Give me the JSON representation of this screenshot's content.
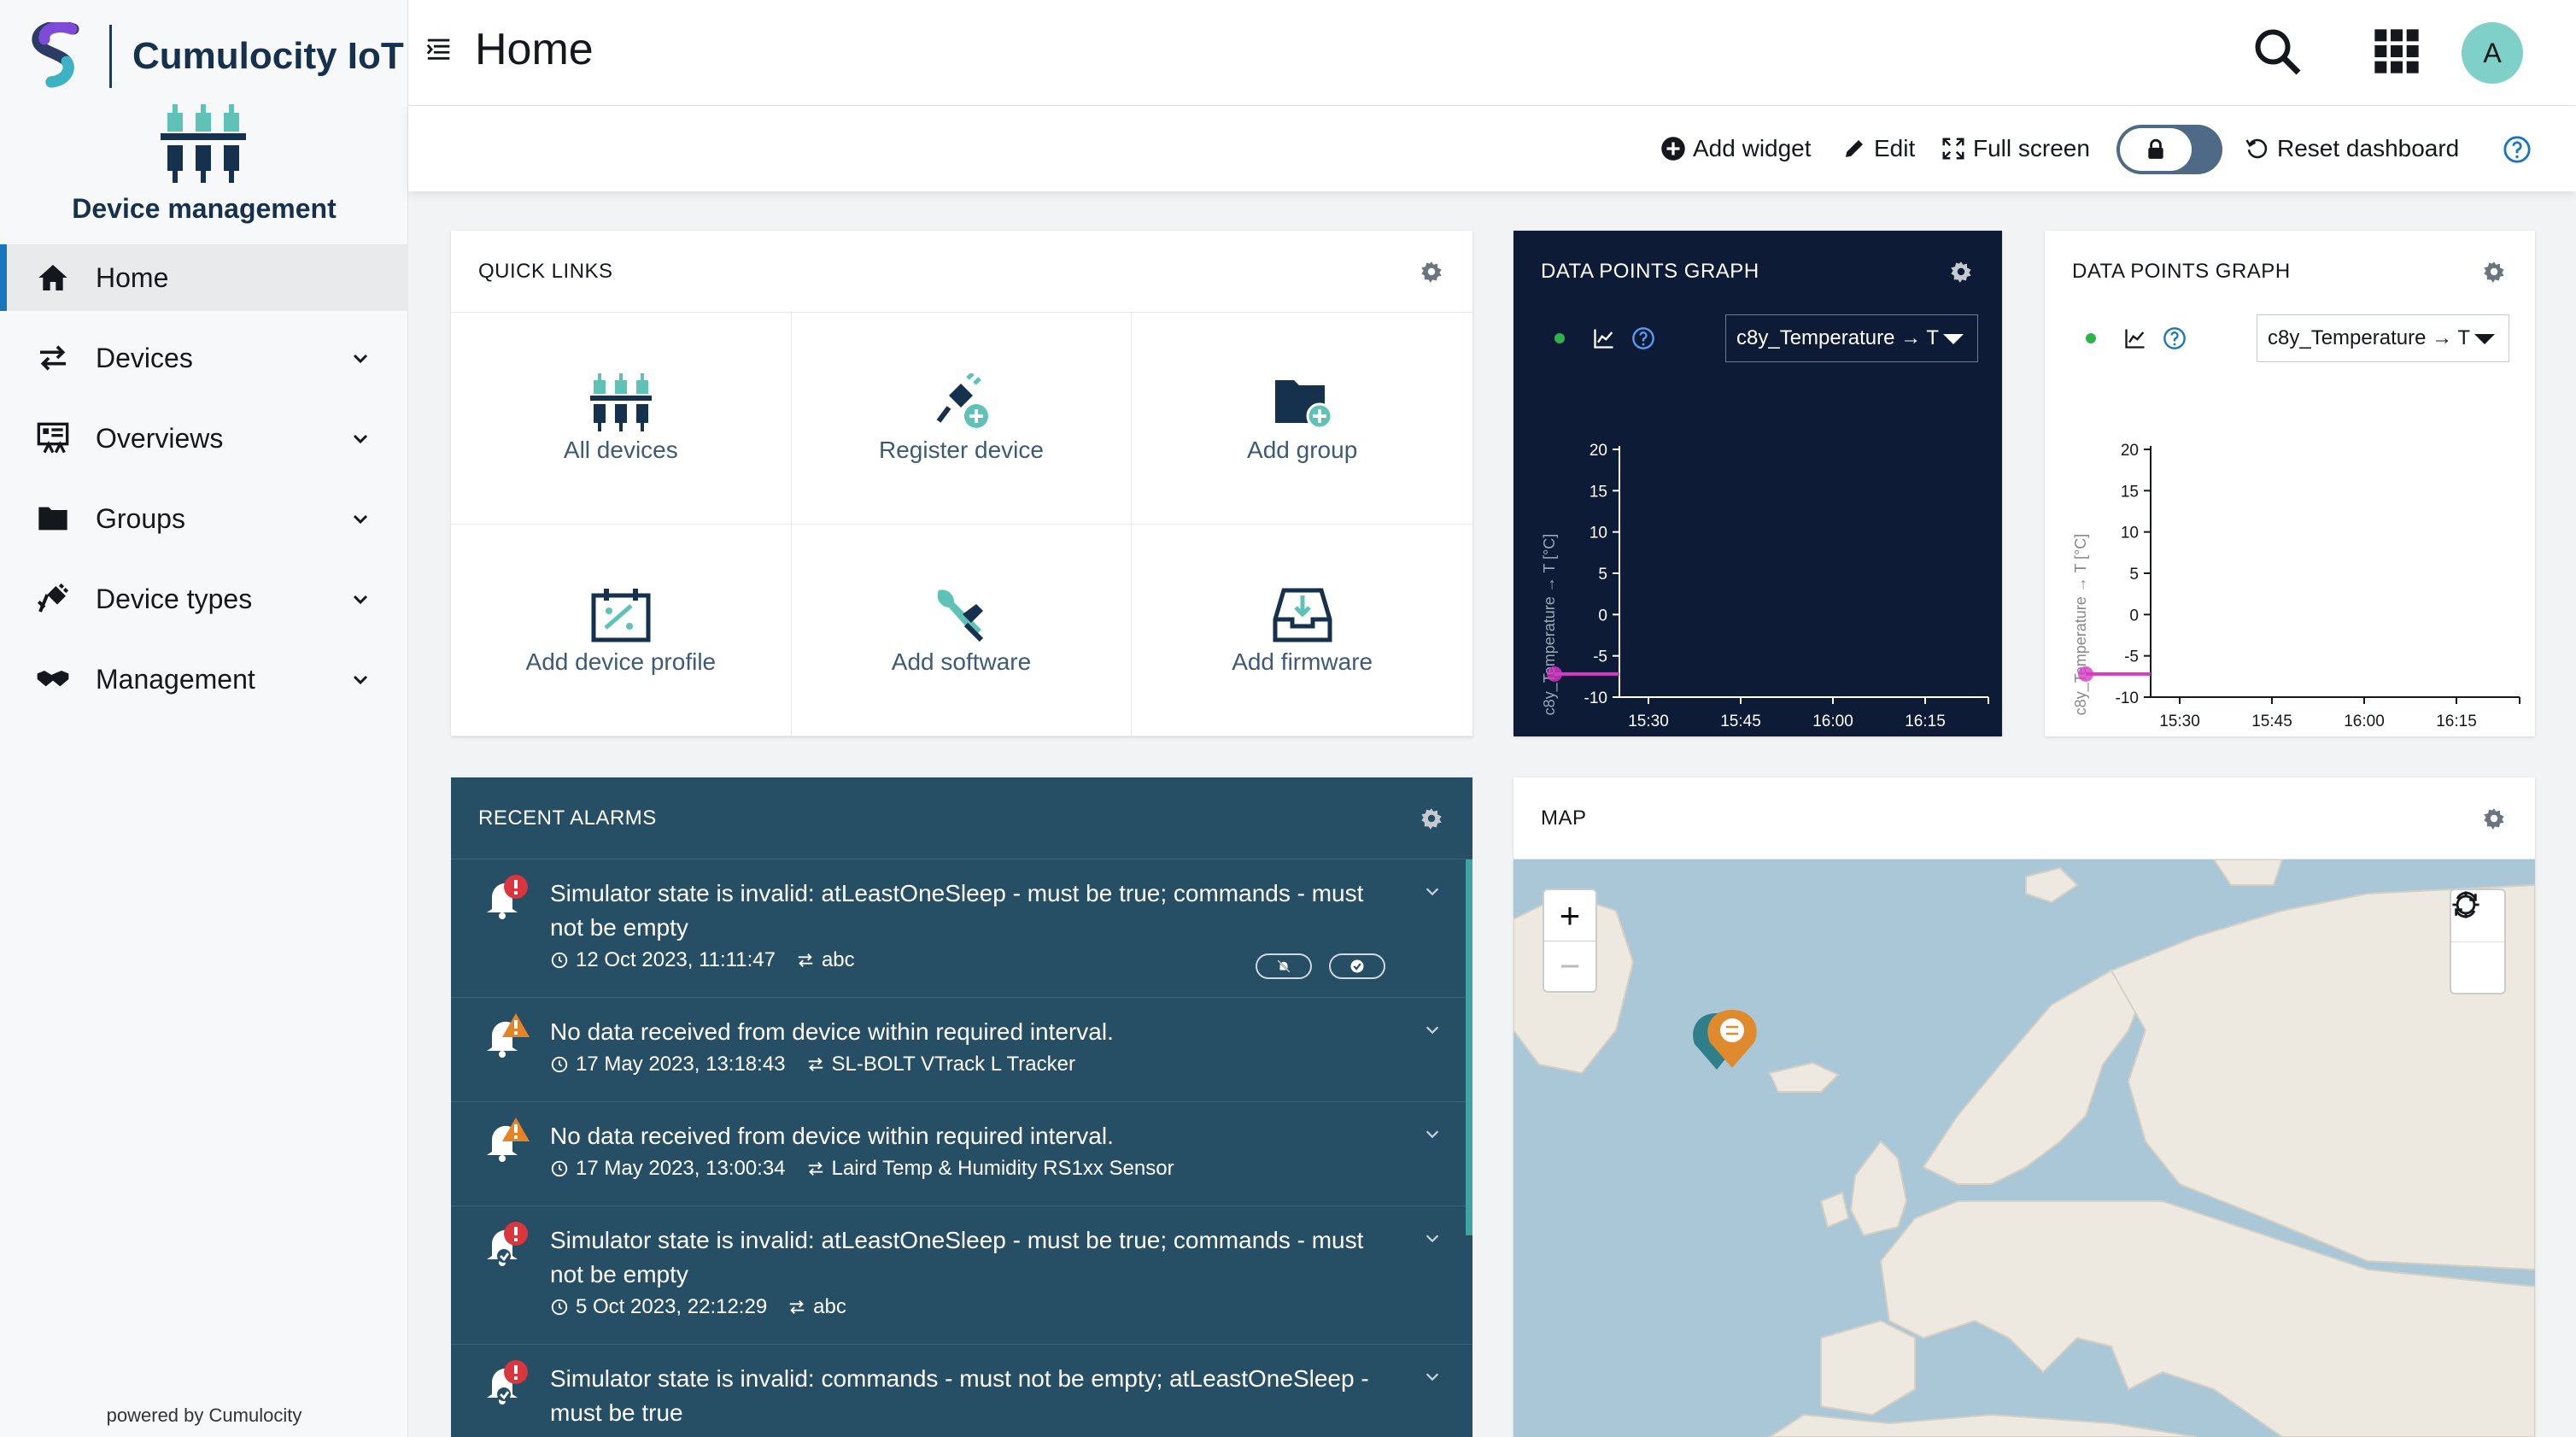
{
  "brand": {
    "name": "Cumulocity IoT"
  },
  "app": {
    "title": "Device management"
  },
  "nav": [
    {
      "label": "Home",
      "icon": "home-icon",
      "active": true
    },
    {
      "label": "Devices",
      "icon": "exchange-icon"
    },
    {
      "label": "Overviews",
      "icon": "dashboard-icon"
    },
    {
      "label": "Groups",
      "icon": "folder-icon"
    },
    {
      "label": "Device types",
      "icon": "plug-icon"
    },
    {
      "label": "Management",
      "icon": "handshake-icon"
    }
  ],
  "footer": {
    "powered": "powered by Cumulocity"
  },
  "header": {
    "title": "Home",
    "avatar": "A"
  },
  "actions": {
    "add_widget": "Add widget",
    "edit": "Edit",
    "full_screen": "Full screen",
    "reset": "Reset dashboard"
  },
  "quick_links": {
    "title": "QUICK LINKS",
    "items": [
      {
        "label": "All devices",
        "icon": "devices-icon"
      },
      {
        "label": "Register device",
        "icon": "plug-add-icon"
      },
      {
        "label": "Add group",
        "icon": "folder-add-icon"
      },
      {
        "label": "Add device profile",
        "icon": "profile-icon"
      },
      {
        "label": "Add software",
        "icon": "software-icon"
      },
      {
        "label": "Add firmware",
        "icon": "firmware-icon"
      }
    ]
  },
  "graphs": [
    {
      "title": "DATA POINTS GRAPH",
      "select": "c8y_Temperature → T",
      "theme": "dark"
    },
    {
      "title": "DATA POINTS GRAPH",
      "select": "c8y_Temperature → T",
      "theme": "light"
    }
  ],
  "chart_data": [
    {
      "type": "line",
      "ylabel": "c8y_Temperature → T [°C]",
      "x_ticks": [
        "15:30",
        "15:45",
        "16:00",
        "16:15"
      ],
      "y_ticks": [
        20,
        15,
        10,
        5,
        0,
        -5,
        -10
      ],
      "ylim": [
        -10,
        20
      ],
      "series": [
        {
          "values": [
            -7.2,
            -7.2
          ],
          "color": "#d63bc4"
        }
      ]
    },
    {
      "type": "line",
      "ylabel": "c8y_Temperature → T [°C]",
      "x_ticks": [
        "15:30",
        "15:45",
        "16:00",
        "16:15"
      ],
      "y_ticks": [
        20,
        15,
        10,
        5,
        0,
        -5,
        -10
      ],
      "ylim": [
        -10,
        20
      ],
      "series": [
        {
          "values": [
            -7.2,
            -7.2
          ],
          "color": "#d63bc4"
        }
      ]
    }
  ],
  "alarms": {
    "title": "RECENT ALARMS",
    "items": [
      {
        "message": "Simulator state is invalid: atLeastOneSleep - must be true; commands - must not be empty",
        "time": "12 Oct 2023, 11:11:47",
        "source": "abc",
        "severity": "critical"
      },
      {
        "message": "No data received from device within required interval.",
        "time": "17 May 2023, 13:18:43",
        "source": "SL-BOLT VTrack L Tracker",
        "severity": "major"
      },
      {
        "message": "No data received from device within required interval.",
        "time": "17 May 2023, 13:00:34",
        "source": "Laird Temp & Humidity RS1xx Sensor",
        "severity": "major"
      },
      {
        "message": "Simulator state is invalid: atLeastOneSleep - must be true; commands - must not be empty",
        "time": "5 Oct 2023, 22:12:29",
        "source": "abc",
        "severity": "critical"
      },
      {
        "message": "Simulator state is invalid: commands - must not be empty; atLeastOneSleep - must be true",
        "time": "",
        "source": "",
        "severity": "critical"
      }
    ]
  },
  "map": {
    "title": "MAP",
    "zoom_in": "+",
    "zoom_out": "−"
  },
  "colors": {
    "accent": "#1776bf",
    "navy": "#0d1b36",
    "alarm_bg": "#264e64",
    "teal": "#3fa39f",
    "critical": "#d9363e",
    "major": "#e58425"
  }
}
